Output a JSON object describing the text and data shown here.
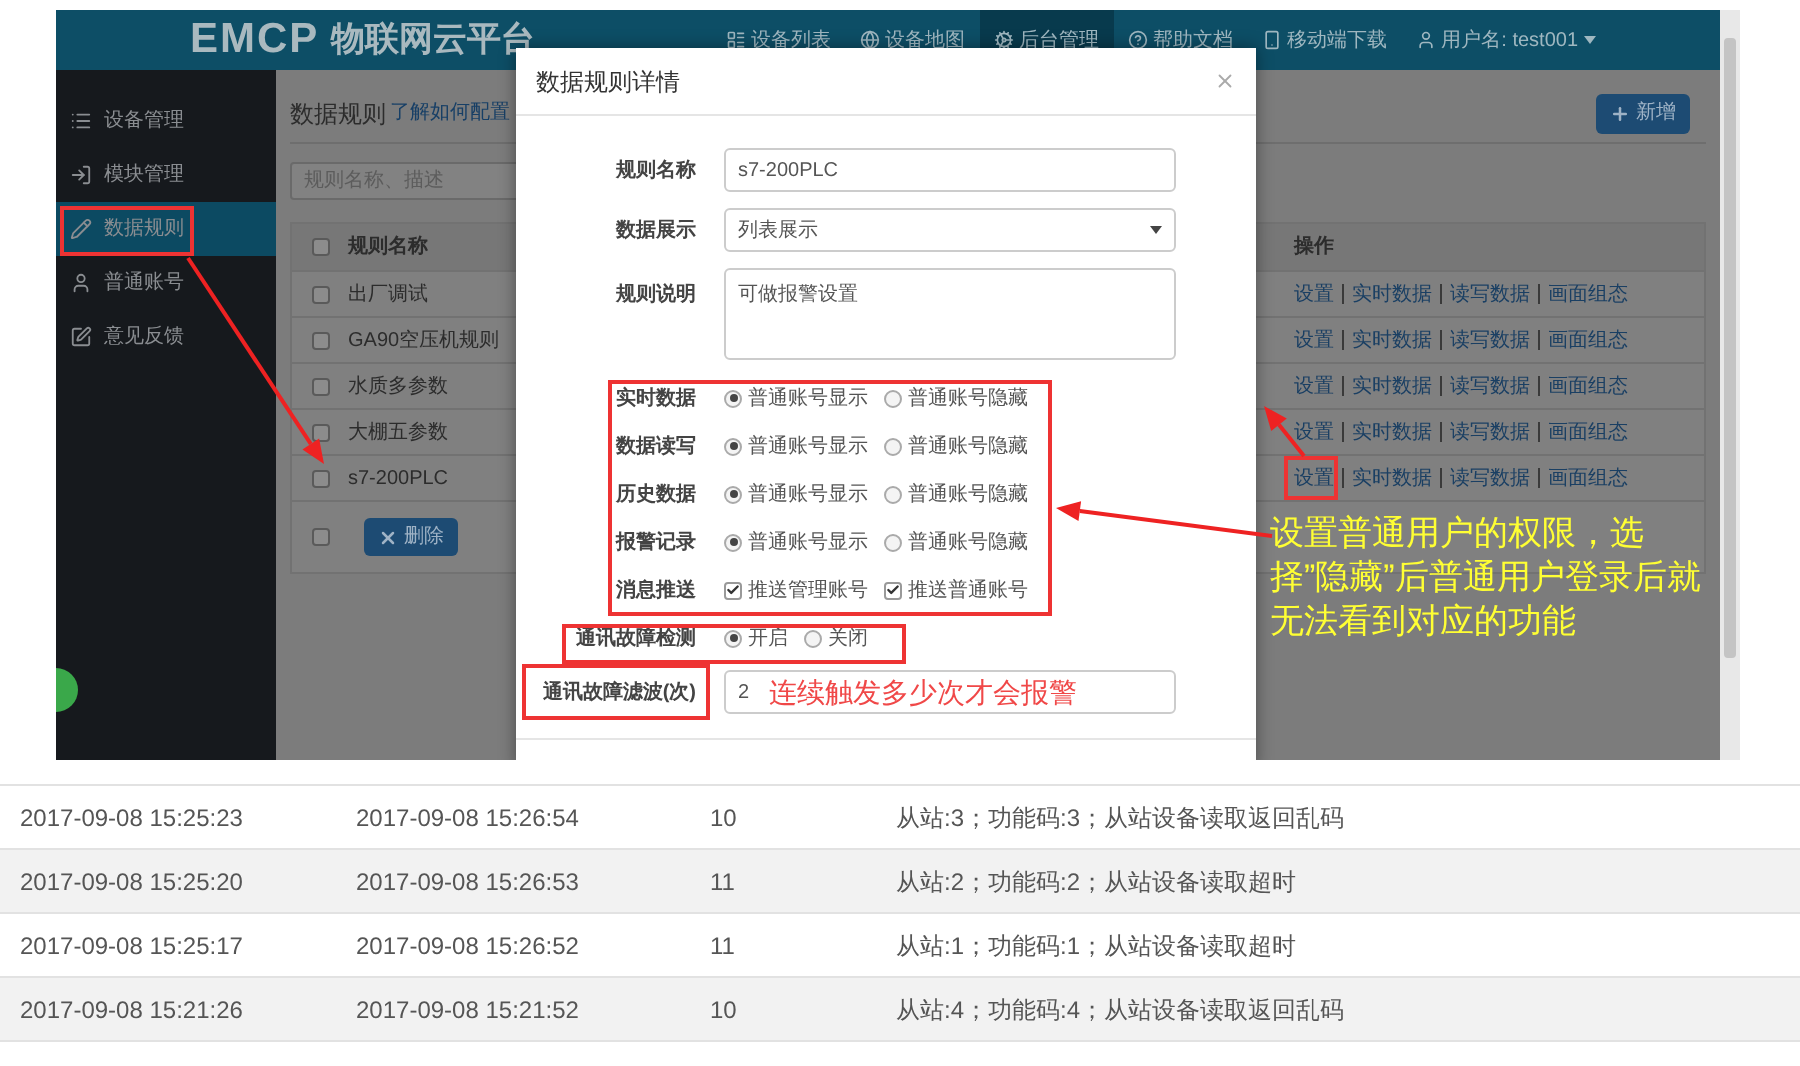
{
  "header": {
    "logo": "EMCP",
    "title": "物联网云平台",
    "nav": [
      {
        "label": "设备列表",
        "selected": false
      },
      {
        "label": "设备地图",
        "selected": false
      },
      {
        "label": "后台管理",
        "selected": true
      },
      {
        "label": "帮助文档",
        "selected": false
      },
      {
        "label": "移动端下载",
        "selected": false
      },
      {
        "label": "用户名: test001",
        "selected": false
      }
    ]
  },
  "sidebar": {
    "items": [
      {
        "label": "设备管理",
        "selected": false
      },
      {
        "label": "模块管理",
        "selected": false
      },
      {
        "label": "数据规则",
        "selected": true
      },
      {
        "label": "普通账号",
        "selected": false
      },
      {
        "label": "意见反馈",
        "selected": false
      }
    ]
  },
  "page": {
    "title": "数据规则",
    "help_link": "了解如何配置",
    "add_button": "新增",
    "search": {
      "placeholder": "规则名称、描述"
    },
    "table": {
      "select_all": {
        "checked": false
      },
      "columns": [
        "规则名称",
        "操作"
      ],
      "rows": [
        {
          "name": "出厂调试",
          "checked": false,
          "actions": [
            "设置",
            "实时数据",
            "读写数据",
            "画面组态"
          ]
        },
        {
          "name": "GA90空压机规则",
          "checked": false,
          "actions": [
            "设置",
            "实时数据",
            "读写数据",
            "画面组态"
          ]
        },
        {
          "name": "水质多参数",
          "checked": false,
          "actions": [
            "设置",
            "实时数据",
            "读写数据",
            "画面组态"
          ]
        },
        {
          "name": "大棚五参数",
          "checked": false,
          "actions": [
            "设置",
            "实时数据",
            "读写数据",
            "画面组态"
          ]
        },
        {
          "name": "s7-200PLC",
          "checked": false,
          "actions": [
            "设置",
            "实时数据",
            "读写数据",
            "画面组态"
          ]
        }
      ]
    },
    "footer": {
      "checked": false,
      "delete_button": "删除"
    }
  },
  "dialog": {
    "title": "数据规则详情",
    "fields": [
      {
        "kind": "text",
        "label": "规则名称",
        "value": "s7-200PLC"
      },
      {
        "kind": "select",
        "label": "数据展示",
        "value": "列表展示"
      },
      {
        "kind": "textarea",
        "label": "规则说明",
        "value": "可做报警设置"
      },
      {
        "kind": "radio",
        "label": "实时数据",
        "options": [
          {
            "label": "普通账号显示",
            "selected": true
          },
          {
            "label": "普通账号隐藏",
            "selected": false
          }
        ]
      },
      {
        "kind": "radio",
        "label": "数据读写",
        "options": [
          {
            "label": "普通账号显示",
            "selected": true
          },
          {
            "label": "普通账号隐藏",
            "selected": false
          }
        ]
      },
      {
        "kind": "radio",
        "label": "历史数据",
        "options": [
          {
            "label": "普通账号显示",
            "selected": true
          },
          {
            "label": "普通账号隐藏",
            "selected": false
          }
        ]
      },
      {
        "kind": "radio",
        "label": "报警记录",
        "options": [
          {
            "label": "普通账号显示",
            "selected": true
          },
          {
            "label": "普通账号隐藏",
            "selected": false
          }
        ]
      },
      {
        "kind": "checkbox",
        "label": "消息推送",
        "options": [
          {
            "label": "推送管理账号",
            "checked": true
          },
          {
            "label": "推送普通账号",
            "checked": true
          }
        ]
      },
      {
        "kind": "radio",
        "label": "通讯故障检测",
        "options": [
          {
            "label": "开启",
            "selected": true
          },
          {
            "label": "关闭",
            "selected": false
          }
        ]
      },
      {
        "kind": "text",
        "label": "通讯故障滤波(次)",
        "value": "2"
      }
    ]
  },
  "annotations": {
    "callout": "设置普通用户的权限，选择”隐藏”后普通用户登录后就无法看到对应的功能",
    "hint": "连续触发多少次才会报警"
  },
  "log_table": {
    "rows": [
      [
        "2017-09-08 15:25:23",
        "2017-09-08 15:26:54",
        "10",
        "从站:3；功能码:3；从站设备读取返回乱码"
      ],
      [
        "2017-09-08 15:25:20",
        "2017-09-08 15:26:53",
        "11",
        "从站:2；功能码:2；从站设备读取超时"
      ],
      [
        "2017-09-08 15:25:17",
        "2017-09-08 15:26:52",
        "11",
        "从站:1；功能码:1；从站设备读取超时"
      ],
      [
        "2017-09-08 15:21:26",
        "2017-09-08 15:21:52",
        "10",
        "从站:4；功能码:4；从站设备读取返回乱码"
      ]
    ]
  }
}
